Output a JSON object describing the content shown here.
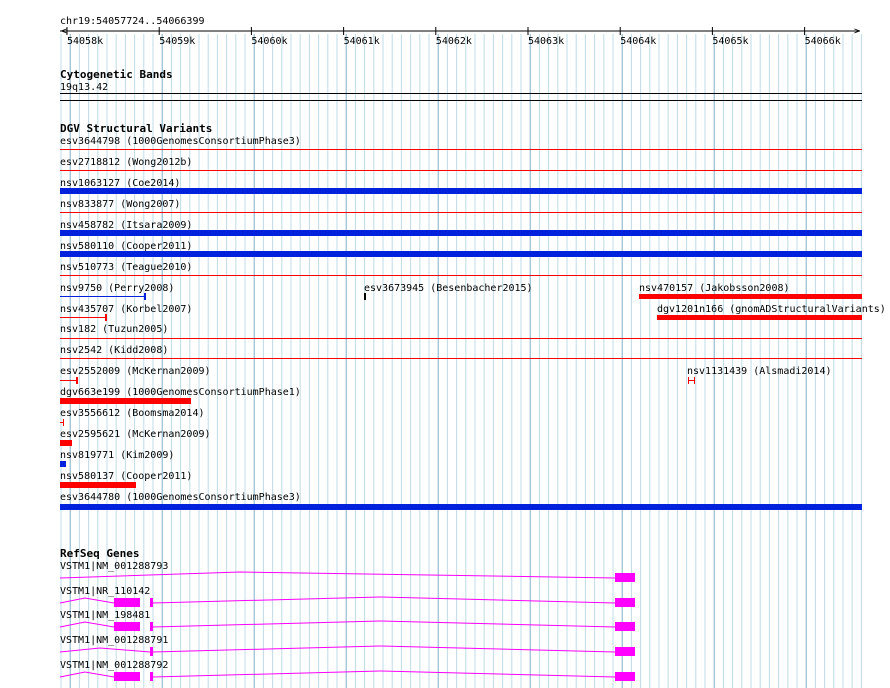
{
  "ruler": {
    "location": "chr19:54057724..54066399",
    "ticks": [
      "54058k",
      "54059k",
      "54060k",
      "54061k",
      "54062k",
      "54063k",
      "54064k",
      "54065k",
      "54066k"
    ]
  },
  "cytoband": {
    "title": "Cytogenetic Bands",
    "band": "19q13.42"
  },
  "dgv": {
    "title": "DGV Structural Variants",
    "features": [
      {
        "label": "esv3644798 (1000GenomesConsortiumPhase3)",
        "color": "#ff0000",
        "style": "line"
      },
      {
        "label": "esv2718812 (Wong2012b)",
        "color": "#ff0000",
        "style": "line"
      },
      {
        "label": "nsv1063127 (Coe2014)",
        "color": "#0022dd",
        "style": "full"
      },
      {
        "label": "nsv833877 (Wong2007)",
        "color": "#ff0000",
        "style": "line"
      },
      {
        "label": "nsv458782 (Itsara2009)",
        "color": "#0022dd",
        "style": "full"
      },
      {
        "label": "nsv580110 (Cooper2011)",
        "color": "#0022dd",
        "style": "full"
      },
      {
        "label": "nsv510773 (Teague2010)",
        "color": "#ff0000",
        "style": "line"
      },
      {
        "label": "nsv9750 (Perry2008)",
        "color": "#0022dd",
        "style": "partial"
      },
      {
        "label": "esv3673945 (Besenbacher2015)",
        "color": "#000000",
        "style": "tick"
      },
      {
        "label": "nsv470157 (Jakobsson2008)",
        "color": "#ff0000",
        "style": "partial"
      },
      {
        "label": "dgv1201n166 (gnomADStructuralVariants)",
        "color": "#ff0000",
        "style": "partial"
      },
      {
        "label": "nsv435707 (Korbel2007)",
        "color": "#ff0000",
        "style": "partial"
      },
      {
        "label": "nsv182 (Tuzun2005)",
        "color": "#ff0000",
        "style": "line"
      },
      {
        "label": "nsv2542 (Kidd2008)",
        "color": "#ff0000",
        "style": "line"
      },
      {
        "label": "esv2552009 (McKernan2009)",
        "color": "#ff0000",
        "style": "partial"
      },
      {
        "label": "nsv1131439 (Alsmadi2014)",
        "color": "#ff0000",
        "style": "partial"
      },
      {
        "label": "dgv663e199 (1000GenomesConsortiumPhase1)",
        "color": "#ff0000",
        "style": "partial"
      },
      {
        "label": "esv3556612 (Boomsma2014)",
        "color": "#ff0000",
        "style": "partial"
      },
      {
        "label": "esv2595621 (McKernan2009)",
        "color": "#ff0000",
        "style": "partial"
      },
      {
        "label": "nsv819771 (Kim2009)",
        "color": "#0022dd",
        "style": "partial"
      },
      {
        "label": "nsv580137 (Cooper2011)",
        "color": "#ff0000",
        "style": "partial"
      },
      {
        "label": "esv3644780 (1000GenomesConsortiumPhase3)",
        "color": "#0022dd",
        "style": "full"
      }
    ]
  },
  "refseq": {
    "title": "RefSeq Genes",
    "color": "#ff00ff",
    "genes": [
      {
        "label": "VSTM1|NM_001288793"
      },
      {
        "label": "VSTM1|NR_110142"
      },
      {
        "label": "VSTM1|NM_198481"
      },
      {
        "label": "VSTM1|NM_001288791"
      },
      {
        "label": "VSTM1|NM_001288792"
      }
    ]
  }
}
